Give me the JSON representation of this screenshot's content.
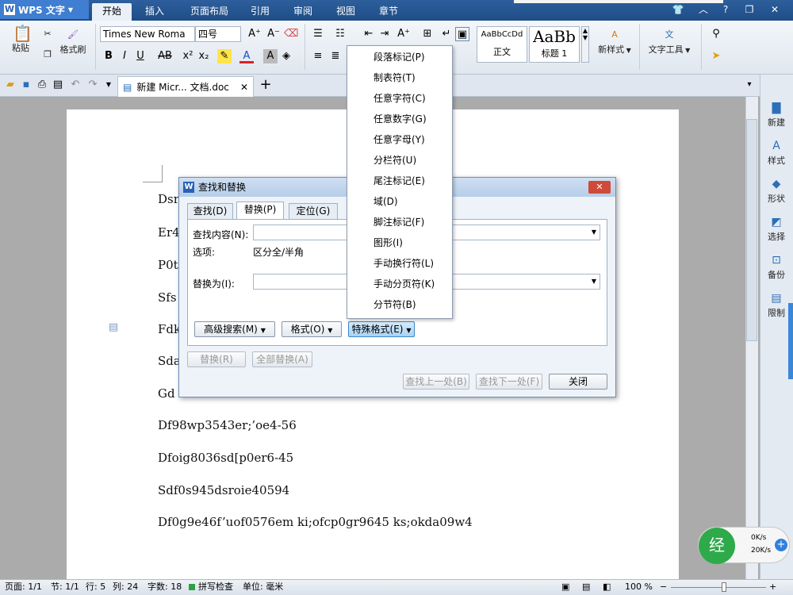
{
  "app": {
    "title": "WPS 文字"
  },
  "menu_tabs": [
    "开始",
    "插入",
    "页面布局",
    "引用",
    "审阅",
    "视图",
    "章节"
  ],
  "ribbon": {
    "paste": "粘贴",
    "format_painter": "格式刷",
    "font_name": "Times New Roma",
    "font_size": "四号",
    "style_normal_preview": "AaBbCcDd",
    "style_normal": "正文",
    "style_h1_preview": "AaBb",
    "style_h1": "标题 1",
    "new_style": "新样式",
    "text_tools": "文字工具"
  },
  "doc_tab": {
    "name": "新建 Micr... 文档.doc"
  },
  "document": {
    "lines": [
      "Dsr",
      "Er4",
      "P0t",
      "Sfs",
      "Fdk",
      "Sda",
      "Gd",
      "Df98wp3543er;’oe4-56",
      "Dfoig8036sd[p0er6-45",
      "Sdf0s945dsroie40594",
      "Df0g9e46f’uof0576em ki;ofcp0gr9645 ks;okda09w4"
    ]
  },
  "sidebar": {
    "items": [
      "新建",
      "样式",
      "形状",
      "选择",
      "备份",
      "限制"
    ]
  },
  "status": {
    "page": "页面: 1/1",
    "section": "节: 1/1",
    "line": "行: 5",
    "column": "列: 24",
    "word_count": "字数: 18",
    "spell": "拼写检查",
    "unit": "单位: 毫米",
    "zoom": "100 %",
    "net_down": "0K/s",
    "net_up": "20K/s"
  },
  "dialog": {
    "title": "查找和替换",
    "tabs": [
      "查找(D)",
      "替换(P)",
      "定位(G)"
    ],
    "find_label": "查找内容(N):",
    "find_value": "",
    "options_label": "选项:",
    "options_value": "区分全/半角",
    "replace_label": "替换为(I):",
    "replace_value": "",
    "advanced_search": "高级搜索(M)",
    "format": "格式(O)",
    "special_format": "特殊格式(E)",
    "replace_btn": "替换(R)",
    "replace_all_btn": "全部替换(A)",
    "find_prev": "查找上一处(B)",
    "find_next": "查找下一处(F)",
    "close": "关闭"
  },
  "special_menu": {
    "items": [
      "段落标记(P)",
      "制表符(T)",
      "任意字符(C)",
      "任意数字(G)",
      "任意字母(Y)",
      "分栏符(U)",
      "尾注标记(E)",
      "域(D)",
      "脚注标记(F)",
      "图形(I)",
      "手动换行符(L)",
      "手动分页符(K)",
      "分节符(B)"
    ]
  }
}
